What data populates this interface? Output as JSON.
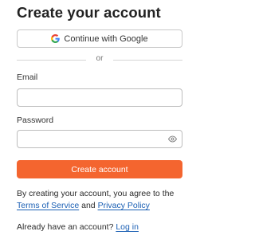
{
  "title": "Create your account",
  "google_button": {
    "label": "Continue with Google",
    "icon": "google-icon"
  },
  "divider": {
    "label": "or"
  },
  "email": {
    "label": "Email",
    "value": "",
    "placeholder": ""
  },
  "password": {
    "label": "Password",
    "value": "",
    "placeholder": "",
    "toggle_icon": "eye-icon"
  },
  "submit": {
    "label": "Create account"
  },
  "terms": {
    "prefix": "By creating your account, you agree to the",
    "tos_label": "Terms of Service",
    "connector": "and",
    "privacy_label": "Privacy Policy"
  },
  "login": {
    "prompt": "Already have an account?",
    "link_label": "Log in"
  },
  "colors": {
    "accent": "#f4652f",
    "link": "#1a5fb4",
    "border": "#bdbdbd"
  }
}
